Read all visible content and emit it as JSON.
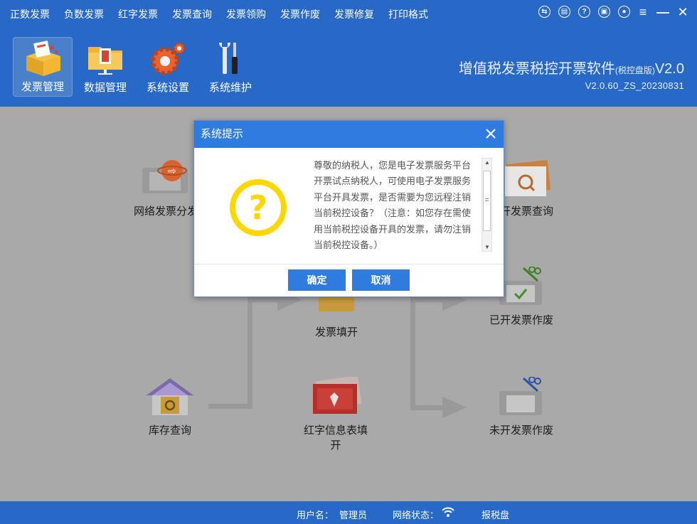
{
  "menu": [
    "正数发票",
    "负数发票",
    "红字发票",
    "发票查询",
    "发票领购",
    "发票作废",
    "发票修复",
    "打印格式"
  ],
  "toolbar": [
    {
      "label": "发票管理",
      "icon": "invoice-box-icon",
      "active": true
    },
    {
      "label": "数据管理",
      "icon": "folder-icon",
      "active": false
    },
    {
      "label": "系统设置",
      "icon": "gear-icon",
      "active": false
    },
    {
      "label": "系统维护",
      "icon": "wrench-screwdriver-icon",
      "active": false
    }
  ],
  "brand": {
    "title": "增值税发票税控开票软件",
    "title_small": "(税控盘版)",
    "title_version": "V2.0",
    "version": "V2.0.60_ZS_20230831"
  },
  "functions": {
    "network_dist": "网络发票分发",
    "invoice_query": "开发票查询",
    "invoice_fill": "发票填开",
    "void_issued": "已开发票作废",
    "stock_query": "库存查询",
    "red_info_line1": "红字信息表填",
    "red_info_line2": "开",
    "void_unissued": "未开发票作废"
  },
  "status": {
    "user_label": "用户名：",
    "user_value": "管理员",
    "network_label": "网络状态：",
    "tax_label": "报税盘"
  },
  "dialog": {
    "title": "系统提示",
    "message": "尊敬的纳税人，您是电子发票服务平台开票试点纳税人，可使用电子发票服务平台开具发票，是否需要为您远程注销当前税控设备？（注意：如您存在需使用当前税控设备开具的发票，请勿注销当前税控设备。）",
    "ok_label": "确定",
    "cancel_label": "取消"
  },
  "colors": {
    "header_blue": "#2868c6",
    "dialog_blue": "#2f7be0",
    "question_yellow": "#ffd700"
  }
}
